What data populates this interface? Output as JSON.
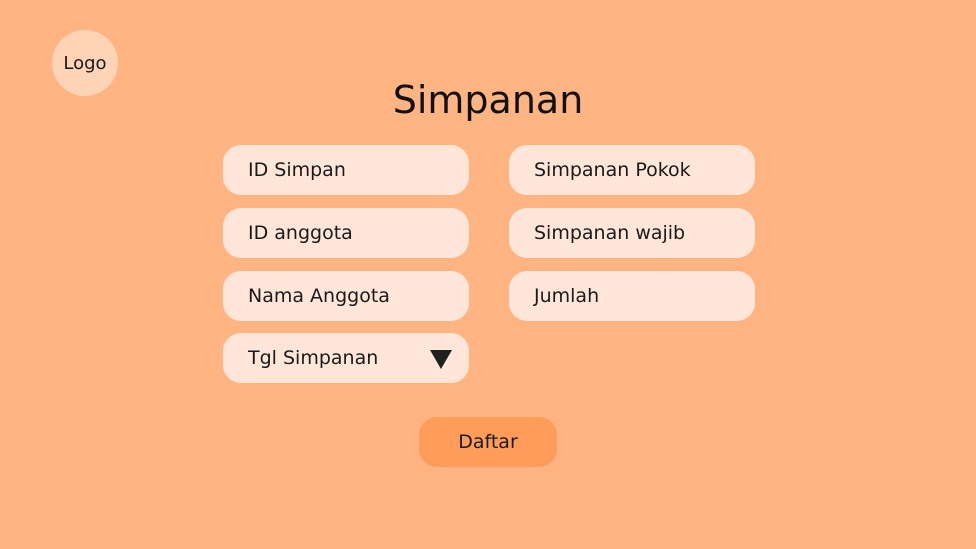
{
  "logo": {
    "label": "Logo"
  },
  "page": {
    "title": "Simpanan"
  },
  "form": {
    "left_fields": [
      {
        "label": "ID Simpan"
      },
      {
        "label": "ID anggota"
      },
      {
        "label": "Nama Anggota"
      },
      {
        "label": "Tgl Simpanan",
        "type": "dropdown",
        "icon": "caret-down-icon"
      }
    ],
    "right_fields": [
      {
        "label": "Simpanan Pokok"
      },
      {
        "label": "Simpanan wajib"
      },
      {
        "label": "Jumlah"
      }
    ],
    "submit_label": "Daftar"
  },
  "colors": {
    "background": "#FFB482",
    "logo_circle": "#FFD4B6",
    "field": "#FFE6D9",
    "button": "#FF9C5A"
  }
}
